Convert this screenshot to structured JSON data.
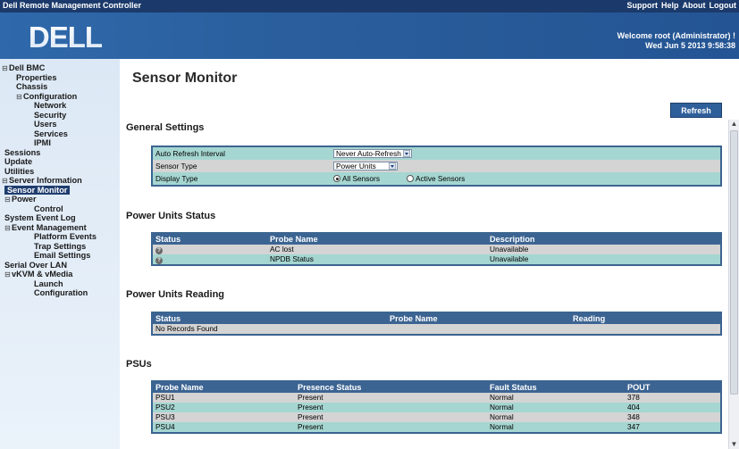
{
  "topbar": {
    "title": "Dell Remote Management Controller",
    "links": [
      "Support",
      "Help",
      "About",
      "Logout"
    ]
  },
  "header": {
    "logo_text": "DELL",
    "welcome": "Welcome root (Administrator) !",
    "datetime": "Wed Jun 5 2013 9:58:38"
  },
  "sidebar": {
    "items": [
      {
        "label": "Dell BMC",
        "toggle": "⊟",
        "indent": 0,
        "selected": false
      },
      {
        "label": "Properties",
        "toggle": "",
        "indent": 1,
        "selected": false
      },
      {
        "label": "Chassis",
        "toggle": "",
        "indent": 1,
        "selected": false
      },
      {
        "label": "Configuration",
        "toggle": "⊟",
        "indent": 1,
        "selected": false
      },
      {
        "label": "Network",
        "toggle": "",
        "indent": 2,
        "selected": false
      },
      {
        "label": "Security",
        "toggle": "",
        "indent": 2,
        "selected": false
      },
      {
        "label": "Users",
        "toggle": "",
        "indent": 2,
        "selected": false
      },
      {
        "label": "Services",
        "toggle": "",
        "indent": 2,
        "selected": false
      },
      {
        "label": "IPMI",
        "toggle": "",
        "indent": 2,
        "selected": false
      },
      {
        "label": "Sessions",
        "toggle": "",
        "indent": 0.5,
        "selected": false
      },
      {
        "label": "Update",
        "toggle": "",
        "indent": 0.5,
        "selected": false
      },
      {
        "label": "Utilities",
        "toggle": "",
        "indent": 0.5,
        "selected": false
      },
      {
        "label": "Server Information",
        "toggle": "⊟",
        "indent": 0,
        "selected": false
      },
      {
        "label": "Sensor Monitor",
        "toggle": "",
        "indent": 0.5,
        "selected": true
      },
      {
        "label": "Power",
        "toggle": "⊟",
        "indent": 0.5,
        "selected": false
      },
      {
        "label": "Control",
        "toggle": "",
        "indent": 2,
        "selected": false
      },
      {
        "label": "System Event Log",
        "toggle": "",
        "indent": 0.5,
        "selected": false
      },
      {
        "label": "Event Management",
        "toggle": "⊟",
        "indent": 0.5,
        "selected": false
      },
      {
        "label": "Platform Events",
        "toggle": "",
        "indent": 2,
        "selected": false
      },
      {
        "label": "Trap Settings",
        "toggle": "",
        "indent": 2,
        "selected": false
      },
      {
        "label": "Email Settings",
        "toggle": "",
        "indent": 2,
        "selected": false
      },
      {
        "label": "Serial Over LAN",
        "toggle": "",
        "indent": 0.5,
        "selected": false
      },
      {
        "label": "vKVM & vMedia",
        "toggle": "⊟",
        "indent": 0.5,
        "selected": false
      },
      {
        "label": "Launch",
        "toggle": "",
        "indent": 2,
        "selected": false
      },
      {
        "label": "Configuration",
        "toggle": "",
        "indent": 2,
        "selected": false
      }
    ]
  },
  "main": {
    "page_title": "Sensor Monitor",
    "refresh_label": "Refresh",
    "general": {
      "title": "General Settings",
      "auto_refresh_label": "Auto Refresh Interval",
      "auto_refresh_value": "Never Auto-Refresh",
      "sensor_type_label": "Sensor Type",
      "sensor_type_value": "Power Units",
      "display_type_label": "Display Type",
      "display_all": "All Sensors",
      "display_active": "Active Sensors"
    },
    "status": {
      "title": "Power Units Status",
      "headers": [
        "Status",
        "Probe Name",
        "Description"
      ],
      "rows": [
        {
          "icon": "question-icon",
          "probe": "AC lost",
          "desc": "Unavailable"
        },
        {
          "icon": "question-icon",
          "probe": "NPDB Status",
          "desc": "Unavailable"
        }
      ]
    },
    "reading": {
      "title": "Power Units Reading",
      "headers": [
        "Status",
        "Probe Name",
        "Reading"
      ],
      "empty": "No Records Found"
    },
    "psus": {
      "title": "PSUs",
      "headers": [
        "Probe Name",
        "Presence Status",
        "Fault Status",
        "POUT"
      ],
      "rows": [
        {
          "name": "PSU1",
          "presence": "Present",
          "fault": "Normal",
          "pout": "378"
        },
        {
          "name": "PSU2",
          "presence": "Present",
          "fault": "Normal",
          "pout": "404"
        },
        {
          "name": "PSU3",
          "presence": "Present",
          "fault": "Normal",
          "pout": "348"
        },
        {
          "name": "PSU4",
          "presence": "Present",
          "fault": "Normal",
          "pout": "347"
        }
      ]
    }
  },
  "colors": {
    "topbar": "#1b3a6b",
    "header": "#2a5e9c",
    "table_header": "#3c6492",
    "row_teal": "#a5d6d1",
    "row_gray": "#d4d4d4",
    "sidebar_selected": "#1f3d6e"
  }
}
